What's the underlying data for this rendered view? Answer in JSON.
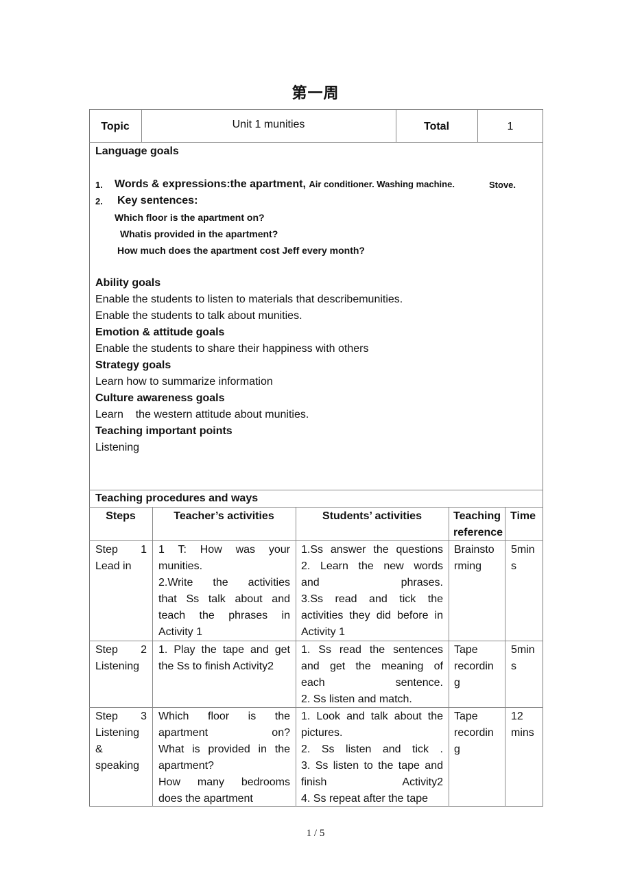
{
  "title": "第一周",
  "header_row": {
    "topic_label": "Topic",
    "topic_value": "Unit 1 munities",
    "total_label": "Total",
    "total_value": "1"
  },
  "goals": {
    "language_goals_heading": "Language goals",
    "words_number": "1.",
    "words_label": "Words & expressions:the apartment,",
    "words_items": "Air conditioner. Washing machine.",
    "words_items_2": "Stove.",
    "key_number": "2.",
    "key_label": "Key sentences:",
    "key_sentences": [
      "Which floor is the apartment on?",
      "Whatis provided in the apartment?",
      "How much does the apartment cost Jeff every month?"
    ],
    "ability_heading": "Ability goals",
    "ability_lines": [
      "Enable the students to listen to materials that describemunities.",
      "Enable the students to talk about munities."
    ],
    "emotion_heading": "Emotion & attitude goals",
    "emotion_line": "Enable the students to share their happiness with others",
    "strategy_heading": "Strategy goals",
    "strategy_line": "Learn how to summarize information",
    "culture_heading": "Culture awareness goals",
    "culture_line": "Learn    the western attitude about munities.",
    "important_heading": "Teaching important points",
    "important_line": "Listening"
  },
  "procedures": {
    "heading": "Teaching procedures and ways",
    "columns": [
      "Steps",
      "Teacher’s activities",
      "Students’ activities",
      "Teaching reference",
      "Time"
    ],
    "rows": [
      {
        "step": [
          "Step 1",
          "Lead in"
        ],
        "teacher": [
          "1 T: How was your",
          "munities.",
          "2.Write the activities",
          "that Ss talk about and",
          "teach the phrases in",
          "Activity 1"
        ],
        "students": [
          "1.Ss answer the questions",
          "2. Learn the new words",
          "and phrases.",
          "3.Ss read and tick the",
          "activities they did before in",
          "Activity 1"
        ],
        "reference": [
          "Brainsto",
          "rming"
        ],
        "time": [
          "5min",
          "s"
        ]
      },
      {
        "step": [
          "Step 2",
          "Listening"
        ],
        "teacher": [
          "1. Play the tape and get",
          " the Ss to finish Activity2"
        ],
        "students": [
          "1. Ss read the sentences",
          "and get the meaning of",
          "each sentence.",
          "2. Ss listen and match."
        ],
        "reference": [
          "Tape",
          "recordin",
          "g"
        ],
        "time": [
          "5min",
          "s"
        ]
      },
      {
        "step": [
          "Step 3",
          "Listening",
          "&",
          "speaking"
        ],
        "teacher": [
          "Which floor is the",
          "apartment on?",
          "What is provided in the",
          "apartment?",
          "How many bedrooms",
          "does the apartment"
        ],
        "students": [
          "1. Look and talk about the",
          "pictures.",
          "2. Ss listen and tick .",
          "3. Ss listen to the tape and",
          "finish Activity2",
          "4. Ss repeat after the tape"
        ],
        "reference": [
          "Tape",
          "recordin",
          "g"
        ],
        "time": [
          "12",
          "mins"
        ]
      }
    ]
  },
  "page_number": "1 / 5"
}
